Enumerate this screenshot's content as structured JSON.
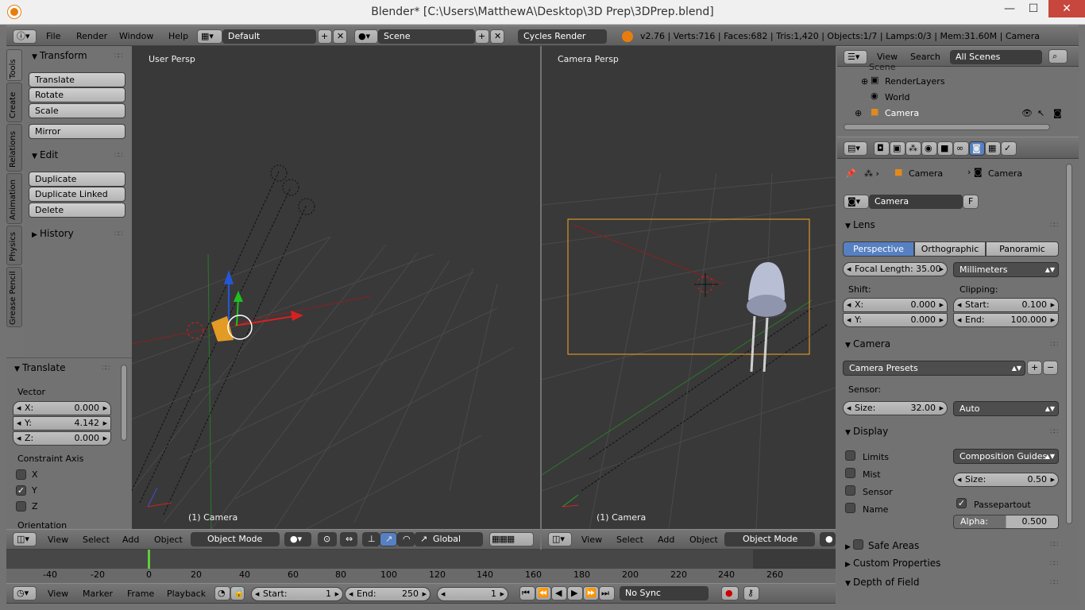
{
  "window": {
    "title": "Blender* [C:\\Users\\MatthewA\\Desktop\\3D Prep\\3DPrep.blend]",
    "min": "—",
    "max": "☐",
    "close": "✕"
  },
  "info_header": {
    "menus": [
      "File",
      "Render",
      "Window",
      "Help"
    ],
    "layout": "Default",
    "scene": "Scene",
    "engine": "Cycles Render",
    "stats": "v2.76 | Verts:716 | Faces:682 | Tris:1,420 | Objects:1/7 | Lamps:0/3 | Mem:31.60M | Camera"
  },
  "tool_tabs": [
    "Tools",
    "Create",
    "Relations",
    "Animation",
    "Physics",
    "Grease Pencil"
  ],
  "tools": {
    "transform_title": "Transform",
    "translate": "Translate",
    "rotate": "Rotate",
    "scale": "Scale",
    "mirror": "Mirror",
    "edit_title": "Edit",
    "duplicate": "Duplicate",
    "duplicate_linked": "Duplicate Linked",
    "delete": "Delete",
    "history_title": "History"
  },
  "operator": {
    "title": "Translate",
    "vector_label": "Vector",
    "x_label": "X:",
    "x_val": "0.000",
    "y_label": "Y:",
    "y_val": "4.142",
    "z_label": "Z:",
    "z_val": "0.000",
    "constraint_label": "Constraint Axis",
    "cx": "X",
    "cy": "Y",
    "cz": "Z",
    "orientation_label": "Orientation"
  },
  "viewport_left": {
    "name": "User Persp",
    "object": "(1) Camera"
  },
  "viewport_right": {
    "name": "Camera Persp",
    "object": "(1) Camera"
  },
  "view3d_header": {
    "menus": [
      "View",
      "Select",
      "Add",
      "Object"
    ],
    "mode": "Object Mode",
    "orientation": "Global"
  },
  "view3d_header_right": {
    "menus": [
      "View",
      "Select",
      "Add",
      "Object"
    ],
    "mode": "Object Mode"
  },
  "outliner": {
    "menus": [
      "View",
      "Search"
    ],
    "filter": "All Scenes",
    "items": [
      "Scene",
      "RenderLayers",
      "World",
      "Camera"
    ]
  },
  "properties": {
    "crumb1": "Camera",
    "crumb2": "Camera",
    "datablock": "Camera",
    "fake": "F",
    "lens_title": "Lens",
    "perspective": "Perspective",
    "orthographic": "Orthographic",
    "panoramic": "Panoramic",
    "focal": "Focal Length: 35.00",
    "units": "Millimeters",
    "shift_label": "Shift:",
    "clip_label": "Clipping:",
    "shift_x_l": "X:",
    "shift_x_v": "0.000",
    "shift_y_l": "Y:",
    "shift_y_v": "0.000",
    "clip_start_l": "Start:",
    "clip_start_v": "0.100",
    "clip_end_l": "End:",
    "clip_end_v": "100.000",
    "camera_title": "Camera",
    "presets": "Camera Presets",
    "sensor_label": "Sensor:",
    "size_l": "Size:",
    "size_v": "32.00",
    "fit": "Auto",
    "display_title": "Display",
    "limits": "Limits",
    "mist": "Mist",
    "sensor": "Sensor",
    "name": "Name",
    "guides": "Composition Guides",
    "dsize_l": "Size:",
    "dsize_v": "0.50",
    "passepartout": "Passepartout",
    "alpha_l": "Alpha:",
    "alpha_v": "0.500",
    "safe_areas": "Safe Areas",
    "custom_props": "Custom Properties",
    "dof": "Depth of Field"
  },
  "timeline": {
    "ticks": [
      "-40",
      "-20",
      "0",
      "20",
      "40",
      "60",
      "80",
      "100",
      "120",
      "140",
      "160",
      "180",
      "200",
      "220",
      "240",
      "260"
    ],
    "menus": [
      "View",
      "Marker",
      "Frame",
      "Playback"
    ],
    "start_l": "Start:",
    "start_v": "1",
    "end_l": "End:",
    "end_v": "250",
    "current": "1",
    "sync": "No Sync"
  },
  "colors": {
    "accent": "#5680c2",
    "viewport": "#393939",
    "panel": "#727272",
    "selected": "#f5a623"
  }
}
